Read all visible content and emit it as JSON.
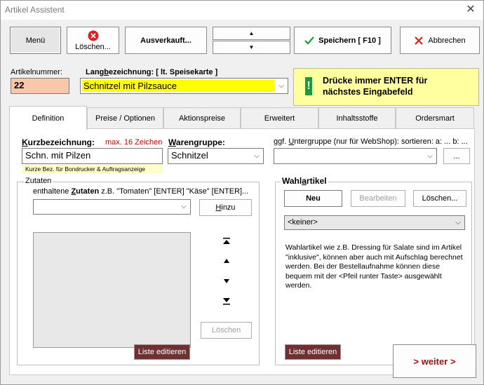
{
  "window": {
    "title": "Artikel Assistent"
  },
  "toolbar": {
    "menu": "Menü",
    "delete": "Löschen...",
    "sold_out": "Ausverkauft...",
    "up": "▲",
    "down": "▼",
    "save": "Speichern [ F10 ]",
    "cancel": "Abbrechen"
  },
  "fields": {
    "artikelnummer_label": "Artikelnummer:",
    "artikelnummer_value": "22",
    "lang_label_pre": "Lang",
    "lang_label_u": "b",
    "lang_label_post": "ezeichnung:  [ lt. Speisekarte ]",
    "lang_value": "Schnitzel mit Pilzsauce"
  },
  "notice": {
    "icon": "!",
    "text_line1": "Drücke immer ENTER für",
    "text_line2": "nächstes Eingabefeld"
  },
  "tabs": [
    "Definition",
    "Preise / Optionen",
    "Aktionspreise",
    "Erweitert",
    "Inhaltsstoffe",
    "Ordersmart"
  ],
  "definition": {
    "kurz_label_u": "K",
    "kurz_label_rest": "urzbezeichnung:",
    "kurz_max": "max. 16 Zeichen",
    "kurz_value": "Schn. mit Pilzen",
    "kurz_hint": "Kurze Bez. für Bondrucker & Auftragsanzeige",
    "waren_label_u": "W",
    "waren_label_rest": "arengruppe:",
    "waren_value": "Schnitzel",
    "unter_label_pre": "ggf. ",
    "unter_label_u": "U",
    "unter_label_rest": "ntergruppe (nur für WebShop): sortieren: a: ... b: ...",
    "unter_value": "",
    "unter_button": "...",
    "zutaten": {
      "title": "Zutaten",
      "hint_pre": "enthaltene ",
      "hint_u": "Z",
      "hint_bold": "utaten",
      "hint_post": " z.B. \"Tomaten\" [ENTER] \"Käse\" [ENTER]...",
      "add_button_pre": "H",
      "add_button_rest": "inzu",
      "delete_button": "Löschen",
      "edit_list": "Liste editieren"
    },
    "wahl": {
      "title_pre": "Wahl",
      "title_u": "a",
      "title_rest": "rtikel",
      "new_button": "Neu",
      "edit_button": "Bearbeiten",
      "delete_button": "Löschen...",
      "select_value": "<keiner>",
      "description": "Wahlartikel wie z.B. Dressing für Salate sind im Artikel \"inklusive\", können aber auch mit Aufschlag berechnet werden. Bei der Bestellaufnahme können diese bequem mit der <Pfeil runter Taste> ausgewählt werden.",
      "edit_list": "Liste editieren"
    },
    "next_button": "> weiter >"
  },
  "colors": {
    "artikelnummer_bg": "#f8c8a8",
    "lang_bg": "#ffff00",
    "notice_bg": "#ffffa0",
    "notice_icon_bg": "#1a9a3a",
    "maroon": "#6e3030",
    "max_red": "#d00000",
    "next_red": "#a01010"
  }
}
